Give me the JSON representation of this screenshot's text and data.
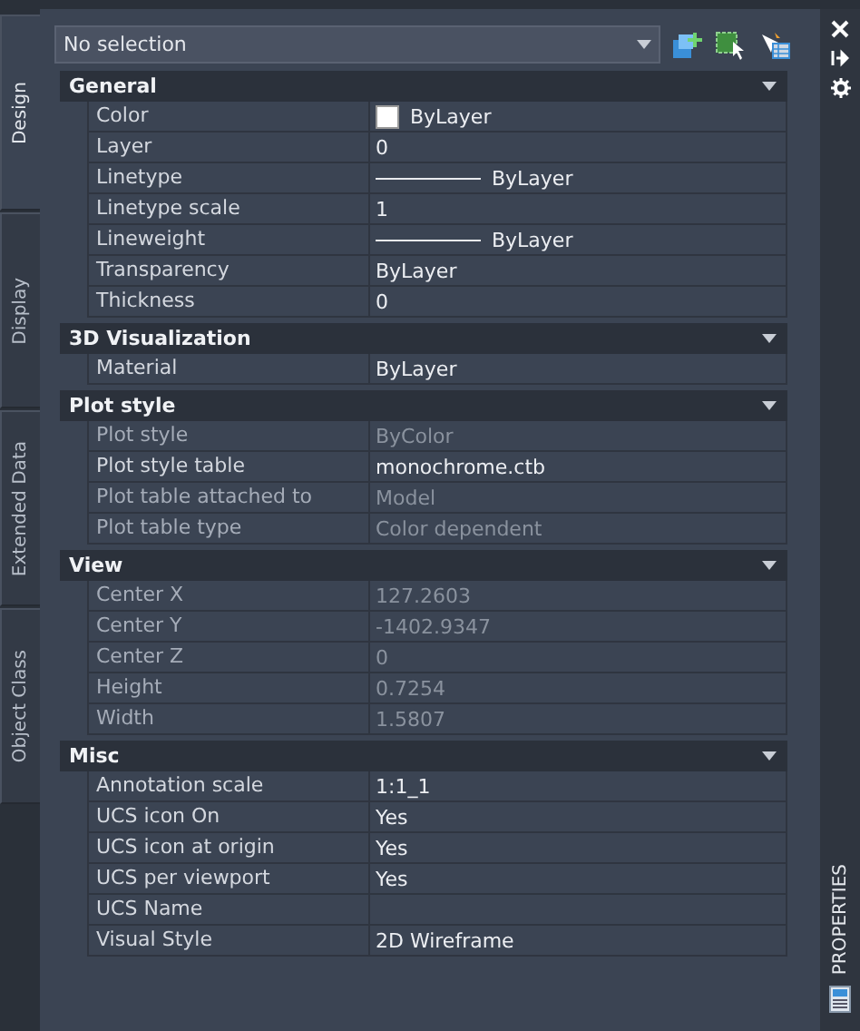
{
  "tabs": [
    {
      "label": "Design",
      "selected": true
    },
    {
      "label": "Display",
      "selected": false
    },
    {
      "label": "Extended Data",
      "selected": false
    },
    {
      "label": "Object Class",
      "selected": false
    }
  ],
  "selector": {
    "value": "No selection"
  },
  "sections": [
    {
      "title": "General",
      "expanded": true,
      "rows": [
        {
          "label": "Color",
          "value": "ByLayer",
          "kind": "color",
          "disabled": false
        },
        {
          "label": "Layer",
          "value": "0",
          "kind": "text",
          "disabled": false
        },
        {
          "label": "Linetype",
          "value": "ByLayer",
          "kind": "line",
          "disabled": false
        },
        {
          "label": "Linetype scale",
          "value": "1",
          "kind": "text",
          "disabled": false
        },
        {
          "label": "Lineweight",
          "value": "ByLayer",
          "kind": "line",
          "disabled": false
        },
        {
          "label": "Transparency",
          "value": "ByLayer",
          "kind": "text",
          "disabled": false
        },
        {
          "label": "Thickness",
          "value": "0",
          "kind": "text",
          "disabled": false
        }
      ]
    },
    {
      "title": "3D Visualization",
      "expanded": true,
      "rows": [
        {
          "label": "Material",
          "value": "ByLayer",
          "kind": "text",
          "disabled": false
        }
      ]
    },
    {
      "title": "Plot style",
      "expanded": true,
      "rows": [
        {
          "label": "Plot style",
          "value": "ByColor",
          "kind": "text",
          "disabled": true
        },
        {
          "label": "Plot style table",
          "value": "monochrome.ctb",
          "kind": "text",
          "disabled": false
        },
        {
          "label": "Plot table attached to",
          "value": "Model",
          "kind": "text",
          "disabled": true
        },
        {
          "label": "Plot table type",
          "value": "Color dependent",
          "kind": "text",
          "disabled": true
        }
      ]
    },
    {
      "title": "View",
      "expanded": true,
      "rows": [
        {
          "label": "Center X",
          "value": "127.2603",
          "kind": "text",
          "disabled": true
        },
        {
          "label": "Center Y",
          "value": "-1402.9347",
          "kind": "text",
          "disabled": true
        },
        {
          "label": "Center Z",
          "value": "0",
          "kind": "text",
          "disabled": true
        },
        {
          "label": "Height",
          "value": "0.7254",
          "kind": "text",
          "disabled": true
        },
        {
          "label": "Width",
          "value": "1.5807",
          "kind": "text",
          "disabled": true
        }
      ]
    },
    {
      "title": "Misc",
      "expanded": true,
      "rows": [
        {
          "label": "Annotation scale",
          "value": "1:1_1",
          "kind": "text",
          "disabled": false
        },
        {
          "label": "UCS icon On",
          "value": "Yes",
          "kind": "text",
          "disabled": false
        },
        {
          "label": "UCS icon at origin",
          "value": "Yes",
          "kind": "text",
          "disabled": false
        },
        {
          "label": "UCS per viewport",
          "value": "Yes",
          "kind": "text",
          "disabled": false
        },
        {
          "label": "UCS Name",
          "kind": "text",
          "disabled": false
        },
        {
          "label": "Visual Style",
          "value": "2D Wireframe",
          "kind": "text",
          "disabled": false
        }
      ]
    }
  ],
  "side_title": "PROPERTIES"
}
